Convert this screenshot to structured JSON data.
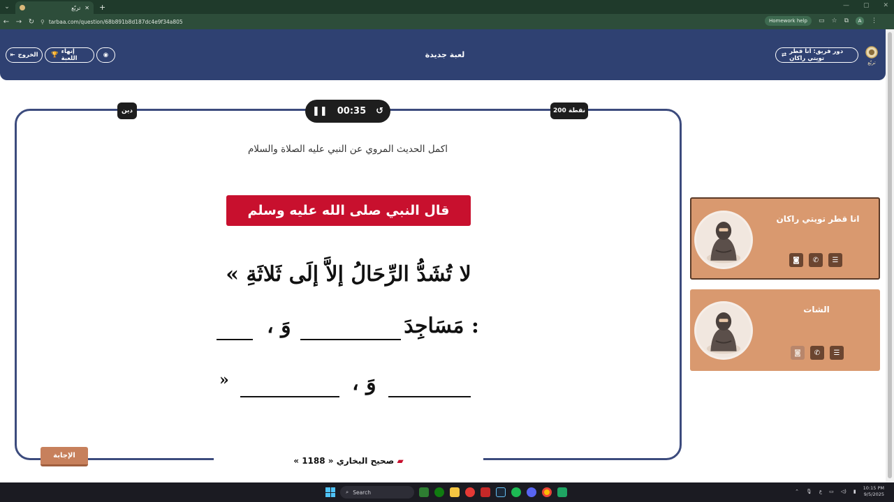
{
  "browser": {
    "tab_title": "تربّع",
    "url": "tarbaa.com/question/68b891b8d187dc4e9f34a805",
    "homework_help": "Homework help",
    "avatar_letter": "A"
  },
  "header": {
    "exit_label": "الخروج",
    "end_game_label": "إنهاء اللعبة",
    "title": "لعبة جديدة",
    "turn_label": "دور فريق: انا قطر تويتي راكان",
    "logo_text": "تربّع"
  },
  "card": {
    "category": "دين",
    "points": "200 نقطة",
    "timer": "00:35",
    "question": "اكمل الحديث المروي عن النبي عليه الصلاة والسلام"
  },
  "hadith": {
    "banner": "قال النبي صلى الله عليه وسلم",
    "line1": "« لا تُشَدُّ الرِّحَالُ إلاَّ إلَى ثَلاثَةِ",
    "line2_word": "مَسَاجِدَ :",
    "line2_and": "، وَ",
    "line3_and": "، وَ",
    "line3_close": "»",
    "source_book": "صحيح البخاري",
    "source_ref": "« 1188 »"
  },
  "answer_button": "الإجابة",
  "players": [
    {
      "name": "انا قطر تويتي راكان"
    },
    {
      "name": "الشات"
    }
  ],
  "taskbar": {
    "search": "Search",
    "time": "10:15 PM",
    "date": "9/5/2025",
    "lang": "ع"
  }
}
